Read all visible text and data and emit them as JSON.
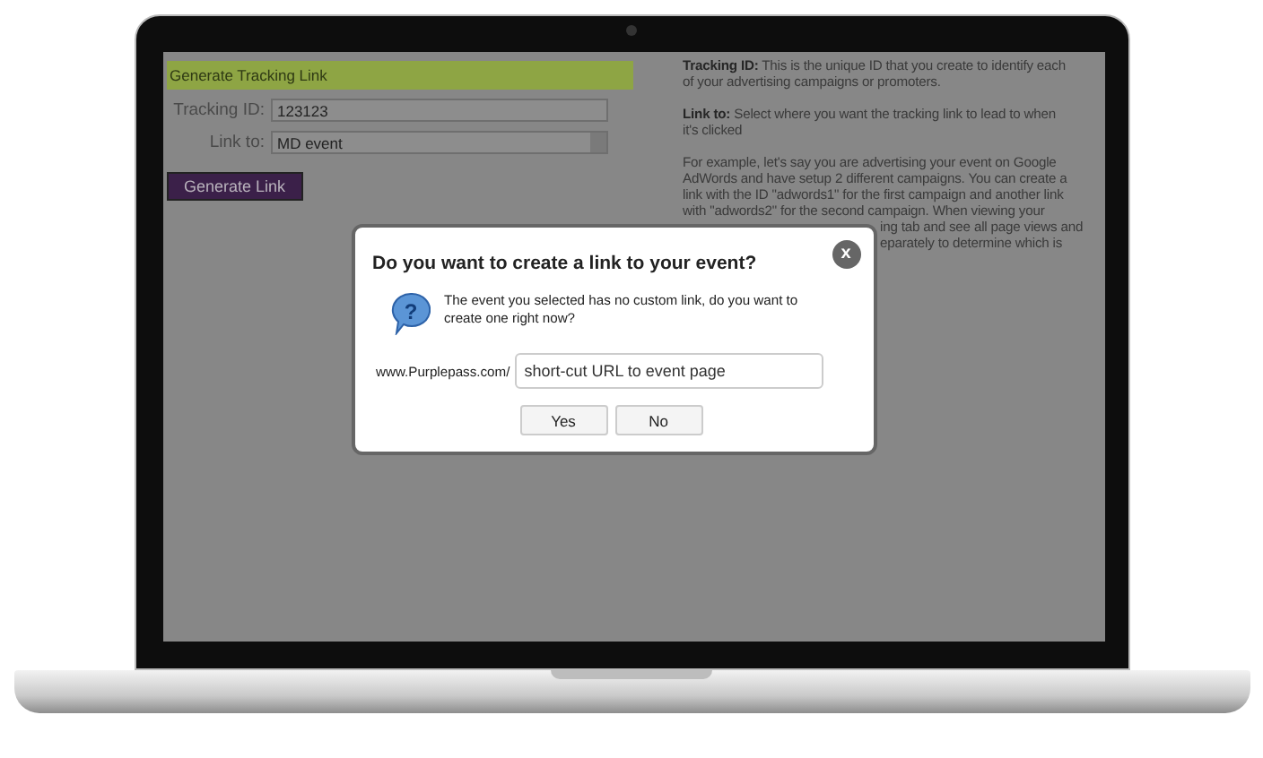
{
  "left_panel": {
    "header": "Generate Tracking Link",
    "fields": [
      {
        "kind": "text",
        "label": "Tracking ID:",
        "value": "123123"
      },
      {
        "kind": "select",
        "label": "Link to:",
        "value": "MD event"
      }
    ],
    "button": "Generate Link"
  },
  "help": {
    "paragraphs": [
      "**Tracking ID:** This is the unique ID that you create to identify each\nof your advertising campaigns or promoters.",
      "**Link to:** Select where you want the tracking link to lead to when\nit's clicked",
      "For example, let's say you are advertising your event on Google\nAdWords and have setup 2 different campaigns. You can create a\nlink with the ID \"adwords1\" for the first campaign and another link\nwith \"adwords2\" for the second campaign. When viewing your"
    ],
    "partial_lines": [
      "ing tab and see all page views and",
      "eparately to determine which is"
    ]
  },
  "dialog": {
    "title": "Do you want to create a link to your event?",
    "message": "The event you selected has no custom link, do you want to\ncreate one right now?",
    "prefix": "www.Purplepass.com/",
    "value": "short-cut URL to event page",
    "close": "x",
    "icon": "?",
    "buttons": [
      "Yes",
      "No"
    ]
  }
}
